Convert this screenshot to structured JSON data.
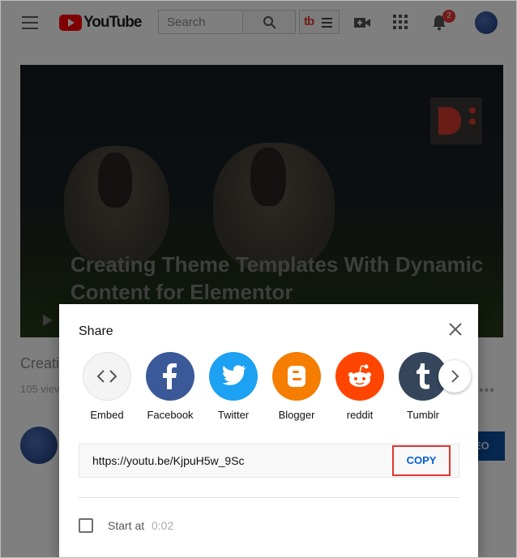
{
  "header": {
    "logo_text": "YouTube",
    "search_placeholder": "Search",
    "notification_count": "2",
    "extension_label": "tb"
  },
  "video": {
    "overlay_title": "Creating Theme Templates With Dynamic Content for Elementor",
    "page_title_partial": "Creati",
    "views_partial": "105 viev",
    "subscribe_partial": "EO"
  },
  "share_dialog": {
    "title": "Share",
    "targets": [
      {
        "label": "Embed",
        "color": "#f2f2f2",
        "icon": "embed-icon"
      },
      {
        "label": "Facebook",
        "color": "#3b5998",
        "icon": "facebook-icon"
      },
      {
        "label": "Twitter",
        "color": "#1da1f2",
        "icon": "twitter-icon"
      },
      {
        "label": "Blogger",
        "color": "#f57d00",
        "icon": "blogger-icon"
      },
      {
        "label": "reddit",
        "color": "#ff4500",
        "icon": "reddit-icon"
      },
      {
        "label": "Tumblr",
        "color": "#35465c",
        "icon": "tumblr-icon"
      }
    ],
    "url": "https://youtu.be/KjpuH5w_9Sc",
    "copy_label": "COPY",
    "start_at_label": "Start at",
    "start_at_time": "0:02",
    "start_at_checked": false
  }
}
